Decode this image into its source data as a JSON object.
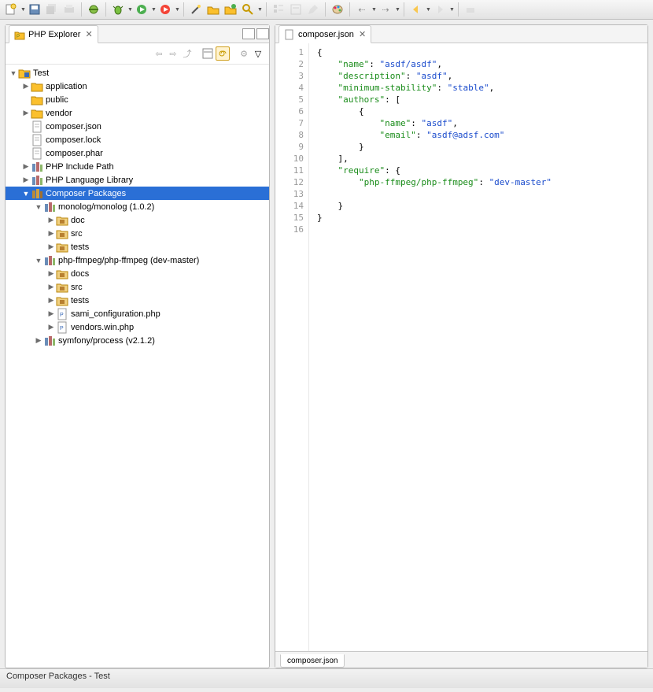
{
  "explorer": {
    "title": "PHP Explorer",
    "project": "Test",
    "nodes": {
      "application": "application",
      "public": "public",
      "vendor": "vendor",
      "composer_json": "composer.json",
      "composer_lock": "composer.lock",
      "composer_phar": "composer.phar",
      "php_include": "PHP Include Path",
      "php_lang": "PHP Language Library",
      "composer_packages": "Composer Packages",
      "monolog": "monolog/monolog (1.0.2)",
      "doc": "doc",
      "src": "src",
      "tests": "tests",
      "ffmpeg": "php-ffmpeg/php-ffmpeg (dev-master)",
      "docs": "docs",
      "src2": "src",
      "tests2": "tests",
      "sami": "sami_configuration.php",
      "vendors_win": "vendors.win.php",
      "symfony": "symfony/process (v2.1.2)"
    }
  },
  "editor": {
    "tab_title": "composer.json",
    "bottom_tab": "composer.json",
    "code": {
      "name_key": "\"name\"",
      "name_val": "\"asdf/asdf\"",
      "desc_key": "\"description\"",
      "desc_val": "\"asdf\"",
      "minstab_key": "\"minimum-stability\"",
      "minstab_val": "\"stable\"",
      "authors_key": "\"authors\"",
      "auth_name_key": "\"name\"",
      "auth_name_val": "\"asdf\"",
      "auth_email_key": "\"email\"",
      "auth_email_val": "\"asdf@adsf.com\"",
      "require_key": "\"require\"",
      "req_pkg_key": "\"php-ffmpeg/php-ffmpeg\"",
      "req_pkg_val": "\"dev-master\""
    },
    "lines": [
      "1",
      "2",
      "3",
      "4",
      "5",
      "6",
      "7",
      "8",
      "9",
      "10",
      "11",
      "12",
      "13",
      "14",
      "15",
      "16"
    ]
  },
  "status": "Composer Packages - Test"
}
